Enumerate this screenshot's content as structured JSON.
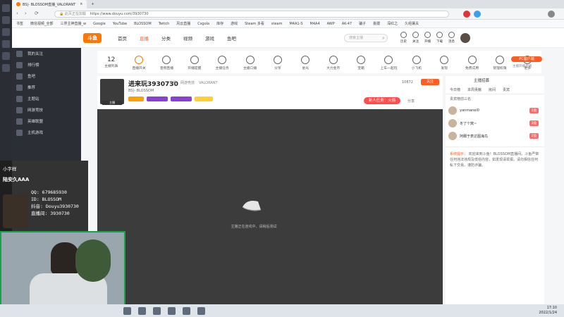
{
  "browser": {
    "tabs": [
      "BS|- BLOSSOM直播_VALORANT",
      ""
    ],
    "url": "https://www.douyu.com/3930730",
    "url_prefix": "此页正在加载",
    "bookmarks": [
      "书签",
      "微信视频_全部",
      "三界主神直播_w",
      "Google",
      "YouTube",
      "BLOSSOM",
      "Twitch",
      "风云直播",
      "Csgola",
      "库存",
      "游戏",
      "Steam 多看",
      "steam",
      "M4A1-S",
      "M4A4",
      "AWP",
      "AK-47",
      "骗子",
      "挑拨",
      "深红之",
      "久经屠夫"
    ]
  },
  "nav": {
    "logo": "斗鱼",
    "links": [
      "首页",
      "直播",
      "分类",
      "视频",
      "游戏",
      "鱼吧"
    ],
    "active": "直播",
    "search_placeholder": "搜索主播",
    "user_icons": [
      "历史",
      "关注",
      "开播",
      "下载",
      "消息"
    ]
  },
  "sidebar": {
    "items": [
      {
        "label": "我的关注"
      },
      {
        "label": "排行榜"
      },
      {
        "label": "鱼吧"
      },
      {
        "label": "推荐"
      },
      {
        "label": "主题站"
      },
      {
        "label": "网游竞技"
      },
      {
        "label": "英雄联盟"
      },
      {
        "label": "主机游戏"
      }
    ]
  },
  "toolbar": {
    "count": "12",
    "count_label": "主播列表",
    "items": [
      "直播开关",
      "音频直播",
      "开播提醒",
      "主播任务",
      "主播口播",
      "分享",
      "星光",
      "大力金币",
      "宝箱",
      "上车一起玩",
      "小飞机",
      "发现",
      "免费试用",
      "管理权限",
      "更多"
    ],
    "pc_client": "PC客户端",
    "pc_client_sub": "主播开播直播"
  },
  "streamer": {
    "name": "进来玩3930730",
    "tags": [
      "举报",
      "网游竞技",
      "VALORANT"
    ],
    "sub": "BS|- BLOSSOM",
    "room_label": "房间",
    "fans": "10872",
    "follow": "关注",
    "task": "新人任务：火箭",
    "share": "分享",
    "badge_label": "主播"
  },
  "video": {
    "status": "主播正在连线中，请稍后测试"
  },
  "right_panel": {
    "header": "主播招募",
    "tabs": [
      "今日榜",
      "本周贡献",
      "房间",
      "贵宾"
    ],
    "rank_title": "贵宾榜前三名",
    "ranks": [
      {
        "name": "yanmanel0",
        "badge": "1级",
        "color": "#ff6a6a"
      },
      {
        "name": "冬了个窝~",
        "badge": "3级",
        "color": "#ff6a6a"
      },
      {
        "name": "阿爾于表达图海鸟",
        "badge": "2级",
        "color": "#ff6a6a"
      }
    ],
    "notice_label": "系统提示：",
    "notice": "欢迎来到斗鱼！BLOSSOM直播间。斗鱼严禁任何违法违规及低俗内容，如发现请举报。请勿相信任何私下交易，谨防诈骗。"
  },
  "overlay": {
    "line1": "小字样",
    "line2": "陆安久AAA",
    "info": [
      "QQ: 679685930",
      "ID: BLOSSOM",
      "抖音: Douyu3930730",
      "直播间: 3930730"
    ]
  },
  "taskbar": {
    "time": "17:10",
    "date": "2022/1/24"
  },
  "colors": {
    "accent": "#ff7700",
    "sidebar": "#2b2e35",
    "video": "#3c3c3c"
  }
}
